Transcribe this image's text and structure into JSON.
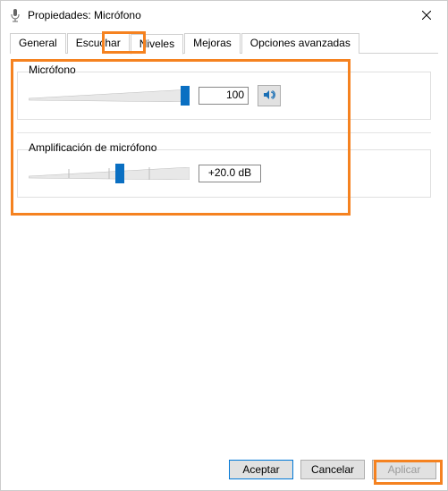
{
  "window": {
    "title": "Propiedades: Micrófono"
  },
  "tabs": {
    "general": "General",
    "escuchar": "Escuchar",
    "niveles": "Niveles",
    "mejoras": "Mejoras",
    "opciones": "Opciones avanzadas",
    "active": "niveles"
  },
  "sliders": {
    "microfono": {
      "label": "Micrófono",
      "value_text": "100",
      "value_pct": 100,
      "mute_icon": "speaker-icon"
    },
    "amplificacion": {
      "label": "Amplificación de micrófono",
      "value_text": "+20.0 dB",
      "value_pct": 57
    }
  },
  "buttons": {
    "aceptar": "Aceptar",
    "cancelar": "Cancelar",
    "aplicar": "Aplicar"
  },
  "annotations": {
    "color": "#f58220",
    "highlighted_tab": "niveles",
    "highlighted_button": "aplicar",
    "highlighted_region": "sliders-panel"
  }
}
